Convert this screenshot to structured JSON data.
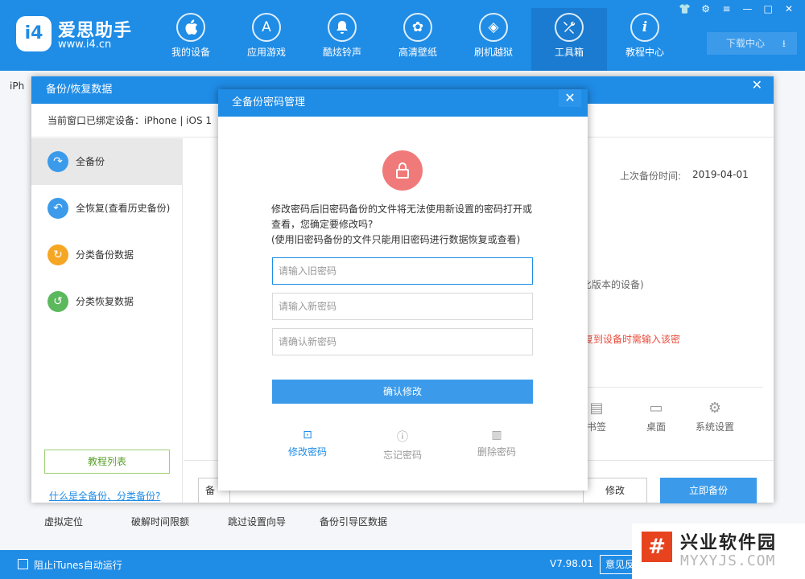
{
  "app": {
    "logo_badge": "i4",
    "logo_name": "爱思助手",
    "logo_url": "www.i4.cn"
  },
  "nav": [
    {
      "label": "我的设备",
      "icon": "apple-icon",
      "glyph": ""
    },
    {
      "label": "应用游戏",
      "icon": "appstore-icon",
      "glyph": "A"
    },
    {
      "label": "酷炫铃声",
      "icon": "bell-icon",
      "glyph": "♪"
    },
    {
      "label": "高清壁纸",
      "icon": "flower-icon",
      "glyph": "✿"
    },
    {
      "label": "刷机越狱",
      "icon": "dropbox-icon",
      "glyph": "◈"
    },
    {
      "label": "工具箱",
      "icon": "tools-icon",
      "glyph": "✕",
      "active": true
    },
    {
      "label": "教程中心",
      "icon": "info-icon",
      "glyph": "i"
    }
  ],
  "download_label": "下载中心",
  "background": {
    "tab_label": "iPh",
    "tools": [
      "虚拟定位",
      "破解时间限额",
      "跳过设置向导",
      "备份引导区数据"
    ]
  },
  "backup_dialog": {
    "title": "备份/恢复数据",
    "device_info": "当前窗口已绑定设备：iPhone  |  iOS 1",
    "sidebar": [
      {
        "label": "全备份",
        "color": "#3b9bea",
        "glyph": "↷"
      },
      {
        "label": "全恢复(查看历史备份)",
        "color": "#3b9bea",
        "glyph": "↶"
      },
      {
        "label": "分类备份数据",
        "color": "#f5a623",
        "glyph": "↻"
      },
      {
        "label": "分类恢复数据",
        "color": "#5cb85c",
        "glyph": "↺"
      }
    ],
    "tutorial_button": "教程列表",
    "help_link": "什么是全备份、分类备份?",
    "last_backup_label": "上次备份时间:",
    "last_backup_value": "2019-04-01",
    "partial_note": "比版本的设备)",
    "partial_warning": "复到设备时需输入该密",
    "tools": [
      {
        "label": "书签",
        "glyph": "▤"
      },
      {
        "label": "桌面",
        "glyph": "▭"
      },
      {
        "label": "系统设置",
        "glyph": "⚙"
      }
    ],
    "path_value": "备",
    "modify_button": "修改",
    "backup_now_button": "立即备份"
  },
  "password_modal": {
    "title": "全备份密码管理",
    "message_line1": "修改密码后旧密码备份的文件将无法使用新设置的密码打开或",
    "message_line2": "查看，您确定要修改吗?",
    "message_line3": "(使用旧密码备份的文件只能用旧密码进行数据恢复或查看)",
    "old_password_placeholder": "请输入旧密码",
    "new_password_placeholder": "请输入新密码",
    "confirm_password_placeholder": "请确认新密码",
    "submit_button": "确认修改",
    "actions": [
      {
        "label": "修改密码",
        "glyph": "🔒",
        "active": true
      },
      {
        "label": "忘记密码",
        "glyph": "?"
      },
      {
        "label": "删除密码",
        "glyph": "🗑"
      }
    ]
  },
  "statusbar": {
    "itunes_label": "阻止iTunes自动运行",
    "version": "V7.98.01",
    "feedback_button": "意见反馈"
  },
  "watermark": {
    "logo_glyph": "#",
    "name": "兴业软件园",
    "url": "MYXYJS.COM"
  }
}
